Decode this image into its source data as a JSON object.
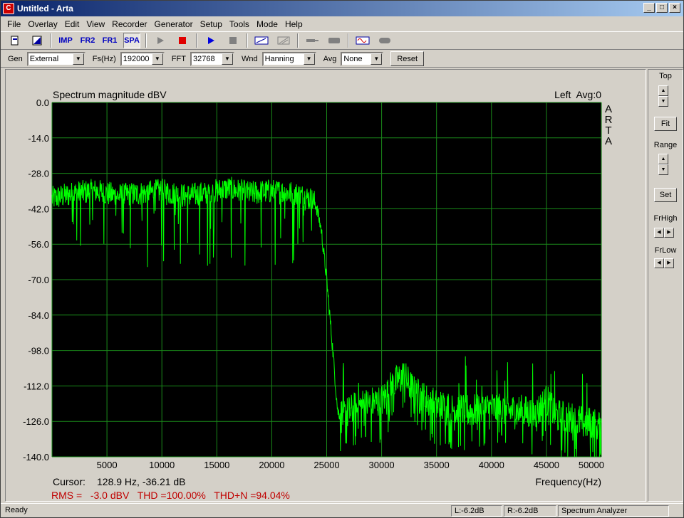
{
  "window": {
    "title": "Untitled - Arta"
  },
  "menu": [
    "File",
    "Overlay",
    "Edit",
    "View",
    "Recorder",
    "Generator",
    "Setup",
    "Tools",
    "Mode",
    "Help"
  ],
  "toolbar": {
    "imp": "IMP",
    "fr2": "FR2",
    "fr1": "FR1",
    "spa": "SPA"
  },
  "settings": {
    "gen_label": "Gen",
    "gen_value": "External",
    "fs_label": "Fs(Hz)",
    "fs_value": "192000",
    "fft_label": "FFT",
    "fft_value": "32768",
    "wnd_label": "Wnd",
    "wnd_value": "Hanning",
    "avg_label": "Avg",
    "avg_value": "None",
    "reset_label": "Reset"
  },
  "side": {
    "top": "Top",
    "fit": "Fit",
    "range": "Range",
    "set": "Set",
    "frhigh": "FrHigh",
    "frlow": "FrLow"
  },
  "plot": {
    "channel_info": "Left  Avg:0",
    "brand": [
      "A",
      "R",
      "T",
      "A"
    ],
    "cursor_label": "Cursor:",
    "cursor_value": "128.9 Hz, -36.21 dB",
    "measurements": "RMS =   -3.0 dBV   THD =100.00%   THD+N =94.04%",
    "trace_color": "#00ff00",
    "grid_color": "#1a8a1a"
  },
  "chart_data": {
    "type": "line",
    "title": "Spectrum magnitude dBV",
    "xlabel": "Frequency(Hz)",
    "ylabel": "",
    "xlim": [
      0,
      50000
    ],
    "ylim": [
      -140,
      0
    ],
    "x_ticks": [
      5000,
      10000,
      15000,
      20000,
      25000,
      30000,
      35000,
      40000,
      45000,
      50000
    ],
    "y_ticks": [
      "0.0",
      "-14.0",
      "-28.0",
      "-42.0",
      "-56.0",
      "-70.0",
      "-84.0",
      "-98.0",
      "-112.0",
      "-126.0",
      "-140.0"
    ],
    "grid": true,
    "series": [
      {
        "color": "#00ff00",
        "x": [
          0,
          2000,
          4000,
          6000,
          8000,
          10000,
          12000,
          14000,
          16000,
          18000,
          20000,
          22000,
          23500,
          24000,
          24500,
          25000,
          25500,
          26000,
          26500,
          28000,
          30000,
          31000,
          32000,
          33000,
          35000,
          38000,
          40000,
          42000,
          44000,
          45000,
          46000,
          48000,
          50000
        ],
        "y": [
          -38,
          -36,
          -35,
          -37,
          -36,
          -35,
          -37,
          -36,
          -34,
          -36,
          -35,
          -36,
          -38,
          -40,
          -50,
          -70,
          -95,
          -122,
          -124,
          -120,
          -118,
          -112,
          -108,
          -115,
          -120,
          -122,
          -121,
          -122,
          -123,
          -118,
          -124,
          -126,
          -128
        ]
      }
    ]
  },
  "status": {
    "ready": "Ready",
    "left": "L:-6.2dB",
    "right": "R:-6.2dB",
    "mode": "Spectrum Analyzer"
  }
}
